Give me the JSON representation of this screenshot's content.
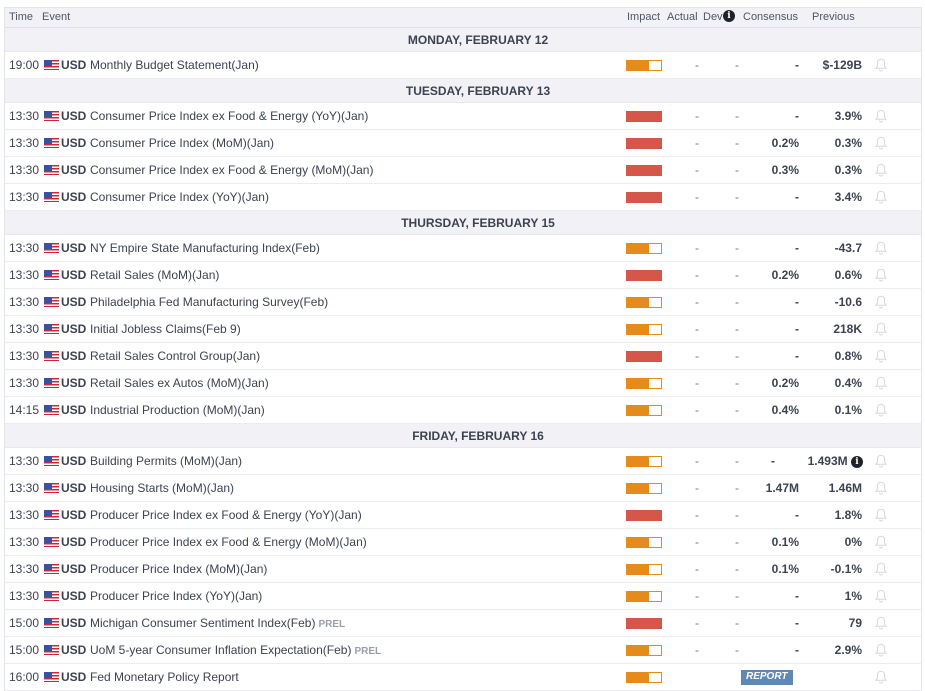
{
  "header": {
    "time": "Time",
    "event": "Event",
    "impact": "Impact",
    "actual": "Actual",
    "dev": "Dev",
    "consensus": "Consensus",
    "previous": "Previous",
    "info_icon": "i"
  },
  "colors": {
    "high_impact": "#d4574a",
    "medium_impact": "#e58b1c",
    "report_badge": "#5f88b5"
  },
  "days": [
    {
      "label": "MONDAY, FEBRUARY 12",
      "events": [
        {
          "time": "19:00",
          "currency": "USD",
          "flag": "us-flag-icon",
          "event": "Monthly Budget Statement(Jan)",
          "tag": "",
          "impact": "medium",
          "actual": "-",
          "dev": "-",
          "consensus": "-",
          "previous": "$-129B"
        }
      ]
    },
    {
      "label": "TUESDAY, FEBRUARY 13",
      "events": [
        {
          "time": "13:30",
          "currency": "USD",
          "flag": "us-flag-icon",
          "event": "Consumer Price Index ex Food & Energy (YoY)(Jan)",
          "tag": "",
          "impact": "high",
          "actual": "-",
          "dev": "-",
          "consensus": "-",
          "previous": "3.9%"
        },
        {
          "time": "13:30",
          "currency": "USD",
          "flag": "us-flag-icon",
          "event": "Consumer Price Index (MoM)(Jan)",
          "tag": "",
          "impact": "high",
          "actual": "-",
          "dev": "-",
          "consensus": "0.2%",
          "previous": "0.3%"
        },
        {
          "time": "13:30",
          "currency": "USD",
          "flag": "us-flag-icon",
          "event": "Consumer Price Index ex Food & Energy (MoM)(Jan)",
          "tag": "",
          "impact": "high",
          "actual": "-",
          "dev": "-",
          "consensus": "0.3%",
          "previous": "0.3%"
        },
        {
          "time": "13:30",
          "currency": "USD",
          "flag": "us-flag-icon",
          "event": "Consumer Price Index (YoY)(Jan)",
          "tag": "",
          "impact": "high",
          "actual": "-",
          "dev": "-",
          "consensus": "-",
          "previous": "3.4%"
        }
      ]
    },
    {
      "label": "THURSDAY, FEBRUARY 15",
      "events": [
        {
          "time": "13:30",
          "currency": "USD",
          "flag": "us-flag-icon",
          "event": "NY Empire State Manufacturing Index(Feb)",
          "tag": "",
          "impact": "medium",
          "actual": "-",
          "dev": "-",
          "consensus": "-",
          "previous": "-43.7"
        },
        {
          "time": "13:30",
          "currency": "USD",
          "flag": "us-flag-icon",
          "event": "Retail Sales (MoM)(Jan)",
          "tag": "",
          "impact": "high",
          "actual": "-",
          "dev": "-",
          "consensus": "0.2%",
          "previous": "0.6%"
        },
        {
          "time": "13:30",
          "currency": "USD",
          "flag": "us-flag-icon",
          "event": "Philadelphia Fed Manufacturing Survey(Feb)",
          "tag": "",
          "impact": "medium",
          "actual": "-",
          "dev": "-",
          "consensus": "-",
          "previous": "-10.6"
        },
        {
          "time": "13:30",
          "currency": "USD",
          "flag": "us-flag-icon",
          "event": "Initial Jobless Claims(Feb 9)",
          "tag": "",
          "impact": "medium",
          "actual": "-",
          "dev": "-",
          "consensus": "-",
          "previous": "218K"
        },
        {
          "time": "13:30",
          "currency": "USD",
          "flag": "us-flag-icon",
          "event": "Retail Sales Control Group(Jan)",
          "tag": "",
          "impact": "high",
          "actual": "-",
          "dev": "-",
          "consensus": "-",
          "previous": "0.8%"
        },
        {
          "time": "13:30",
          "currency": "USD",
          "flag": "us-flag-icon",
          "event": "Retail Sales ex Autos (MoM)(Jan)",
          "tag": "",
          "impact": "medium",
          "actual": "-",
          "dev": "-",
          "consensus": "0.2%",
          "previous": "0.4%"
        },
        {
          "time": "14:15",
          "currency": "USD",
          "flag": "us-flag-icon",
          "event": "Industrial Production (MoM)(Jan)",
          "tag": "",
          "impact": "medium",
          "actual": "-",
          "dev": "-",
          "consensus": "0.4%",
          "previous": "0.1%"
        }
      ]
    },
    {
      "label": "FRIDAY, FEBRUARY 16",
      "events": [
        {
          "time": "13:30",
          "currency": "USD",
          "flag": "us-flag-icon",
          "event": "Building Permits (MoM)(Jan)",
          "tag": "",
          "impact": "medium",
          "actual": "-",
          "dev": "-",
          "consensus": "-",
          "previous": "1.493M",
          "previous_info": true
        },
        {
          "time": "13:30",
          "currency": "USD",
          "flag": "us-flag-icon",
          "event": "Housing Starts (MoM)(Jan)",
          "tag": "",
          "impact": "medium",
          "actual": "-",
          "dev": "-",
          "consensus": "1.47M",
          "previous": "1.46M"
        },
        {
          "time": "13:30",
          "currency": "USD",
          "flag": "us-flag-icon",
          "event": "Producer Price Index ex Food & Energy (YoY)(Jan)",
          "tag": "",
          "impact": "high",
          "actual": "-",
          "dev": "-",
          "consensus": "-",
          "previous": "1.8%"
        },
        {
          "time": "13:30",
          "currency": "USD",
          "flag": "us-flag-icon",
          "event": "Producer Price Index ex Food & Energy (MoM)(Jan)",
          "tag": "",
          "impact": "medium",
          "actual": "-",
          "dev": "-",
          "consensus": "0.1%",
          "previous": "0%"
        },
        {
          "time": "13:30",
          "currency": "USD",
          "flag": "us-flag-icon",
          "event": "Producer Price Index (MoM)(Jan)",
          "tag": "",
          "impact": "medium",
          "actual": "-",
          "dev": "-",
          "consensus": "0.1%",
          "previous": "-0.1%"
        },
        {
          "time": "13:30",
          "currency": "USD",
          "flag": "us-flag-icon",
          "event": "Producer Price Index (YoY)(Jan)",
          "tag": "",
          "impact": "medium",
          "actual": "-",
          "dev": "-",
          "consensus": "-",
          "previous": "1%"
        },
        {
          "time": "15:00",
          "currency": "USD",
          "flag": "us-flag-icon",
          "event": "Michigan Consumer Sentiment Index(Feb)",
          "tag": "PREL",
          "impact": "high",
          "actual": "-",
          "dev": "-",
          "consensus": "-",
          "previous": "79"
        },
        {
          "time": "15:00",
          "currency": "USD",
          "flag": "us-flag-icon",
          "event": "UoM 5-year Consumer Inflation Expectation(Feb)",
          "tag": "PREL",
          "impact": "medium",
          "actual": "-",
          "dev": "-",
          "consensus": "-",
          "previous": "2.9%"
        },
        {
          "time": "16:00",
          "currency": "USD",
          "flag": "us-flag-icon",
          "event": "Fed Monetary Policy Report",
          "tag": "",
          "impact": "medium",
          "report": "REPORT"
        }
      ]
    }
  ]
}
